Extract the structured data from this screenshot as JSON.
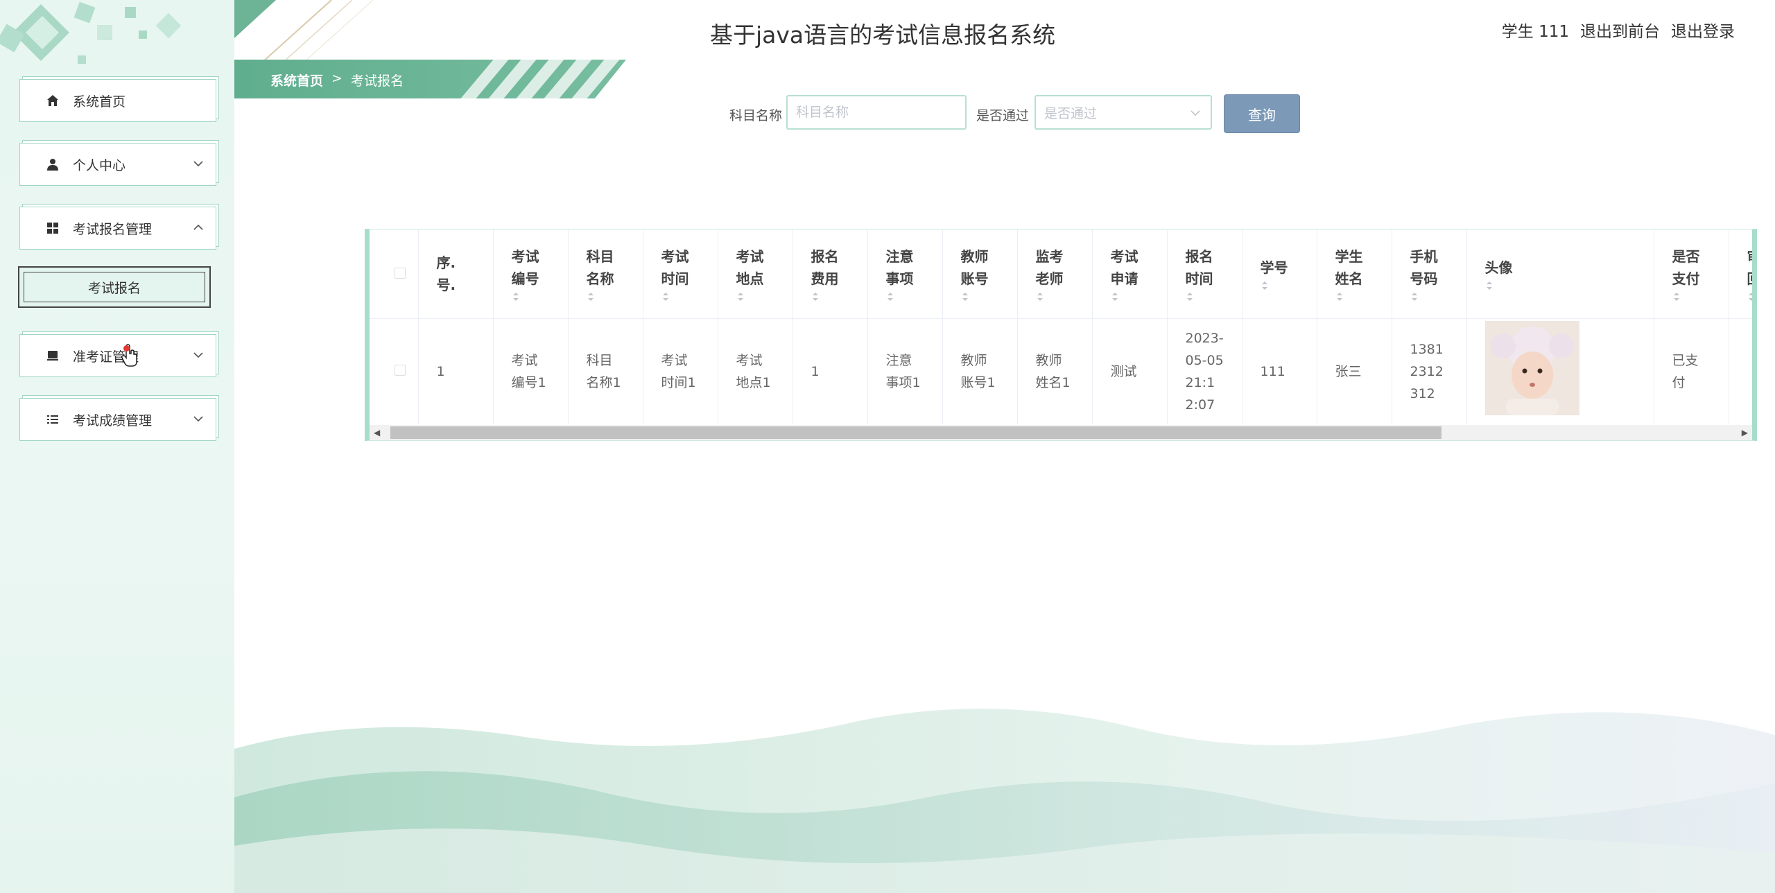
{
  "app": {
    "title": "基于java语言的考试信息报名系统"
  },
  "user_area": {
    "user_label": "学生 111",
    "front_link": "退出到前台",
    "logout_link": "退出登录"
  },
  "breadcrumb": {
    "home": "系统首页",
    "separator": ">",
    "current": "考试报名"
  },
  "sidebar": {
    "items": [
      {
        "label": "系统首页",
        "icon": "home-icon"
      },
      {
        "label": "个人中心",
        "icon": "user-icon"
      },
      {
        "label": "考试报名管理",
        "icon": "grid-icon"
      },
      {
        "label": "准考证管理",
        "icon": "card-icon"
      },
      {
        "label": "考试成绩管理",
        "icon": "list-icon"
      }
    ],
    "subitem": {
      "label": "考试报名"
    }
  },
  "search": {
    "subject_label": "科目名称",
    "subject_placeholder": "科目名称",
    "pass_label": "是否通过",
    "pass_placeholder": "是否通过",
    "button_label": "查询"
  },
  "table": {
    "headers": [
      "序号",
      "考试编号",
      "科目名称",
      "考试时间",
      "考试地点",
      "报名费用",
      "注意事项",
      "教师账号",
      "监考老师",
      "考试申请",
      "报名时间",
      "学号",
      "学生姓名",
      "手机号码",
      "头像",
      "是否支付",
      "审核回复"
    ],
    "header_lines": [
      [
        "序.",
        "号."
      ],
      [
        "考试",
        "编号"
      ],
      [
        "科目",
        "名称"
      ],
      [
        "考试",
        "时间"
      ],
      [
        "考试",
        "地点"
      ],
      [
        "报名",
        "费用"
      ],
      [
        "注意",
        "事项"
      ],
      [
        "教师",
        "账号"
      ],
      [
        "监考",
        "老师"
      ],
      [
        "考试",
        "申请"
      ],
      [
        "报名",
        "时间"
      ],
      [
        "学号"
      ],
      [
        "学生",
        "姓名"
      ],
      [
        "手机",
        "号码"
      ],
      [
        "头像"
      ],
      [
        "是否",
        "支付"
      ],
      [
        "审核",
        "回复"
      ]
    ],
    "rows": [
      {
        "cells": [
          [
            "1"
          ],
          [
            "考试",
            "编号1"
          ],
          [
            "科目",
            "名称1"
          ],
          [
            "考试",
            "时间1"
          ],
          [
            "考试",
            "地点1"
          ],
          [
            "1"
          ],
          [
            "注意",
            "事项1"
          ],
          [
            "教师",
            "账号1"
          ],
          [
            "教师",
            "姓名1"
          ],
          [
            "测试"
          ],
          [
            "2023-",
            "05-05",
            "21:1",
            "2:07"
          ],
          [
            "111"
          ],
          [
            "张三"
          ],
          [
            "1381",
            "2312",
            "312"
          ],
          [
            ""
          ],
          [
            "已支",
            "付"
          ],
          [
            ""
          ]
        ]
      }
    ]
  },
  "colors": {
    "accent": "#6db396",
    "button": "#7c9ab8",
    "sidebar_bg": "#e8f6f1"
  }
}
